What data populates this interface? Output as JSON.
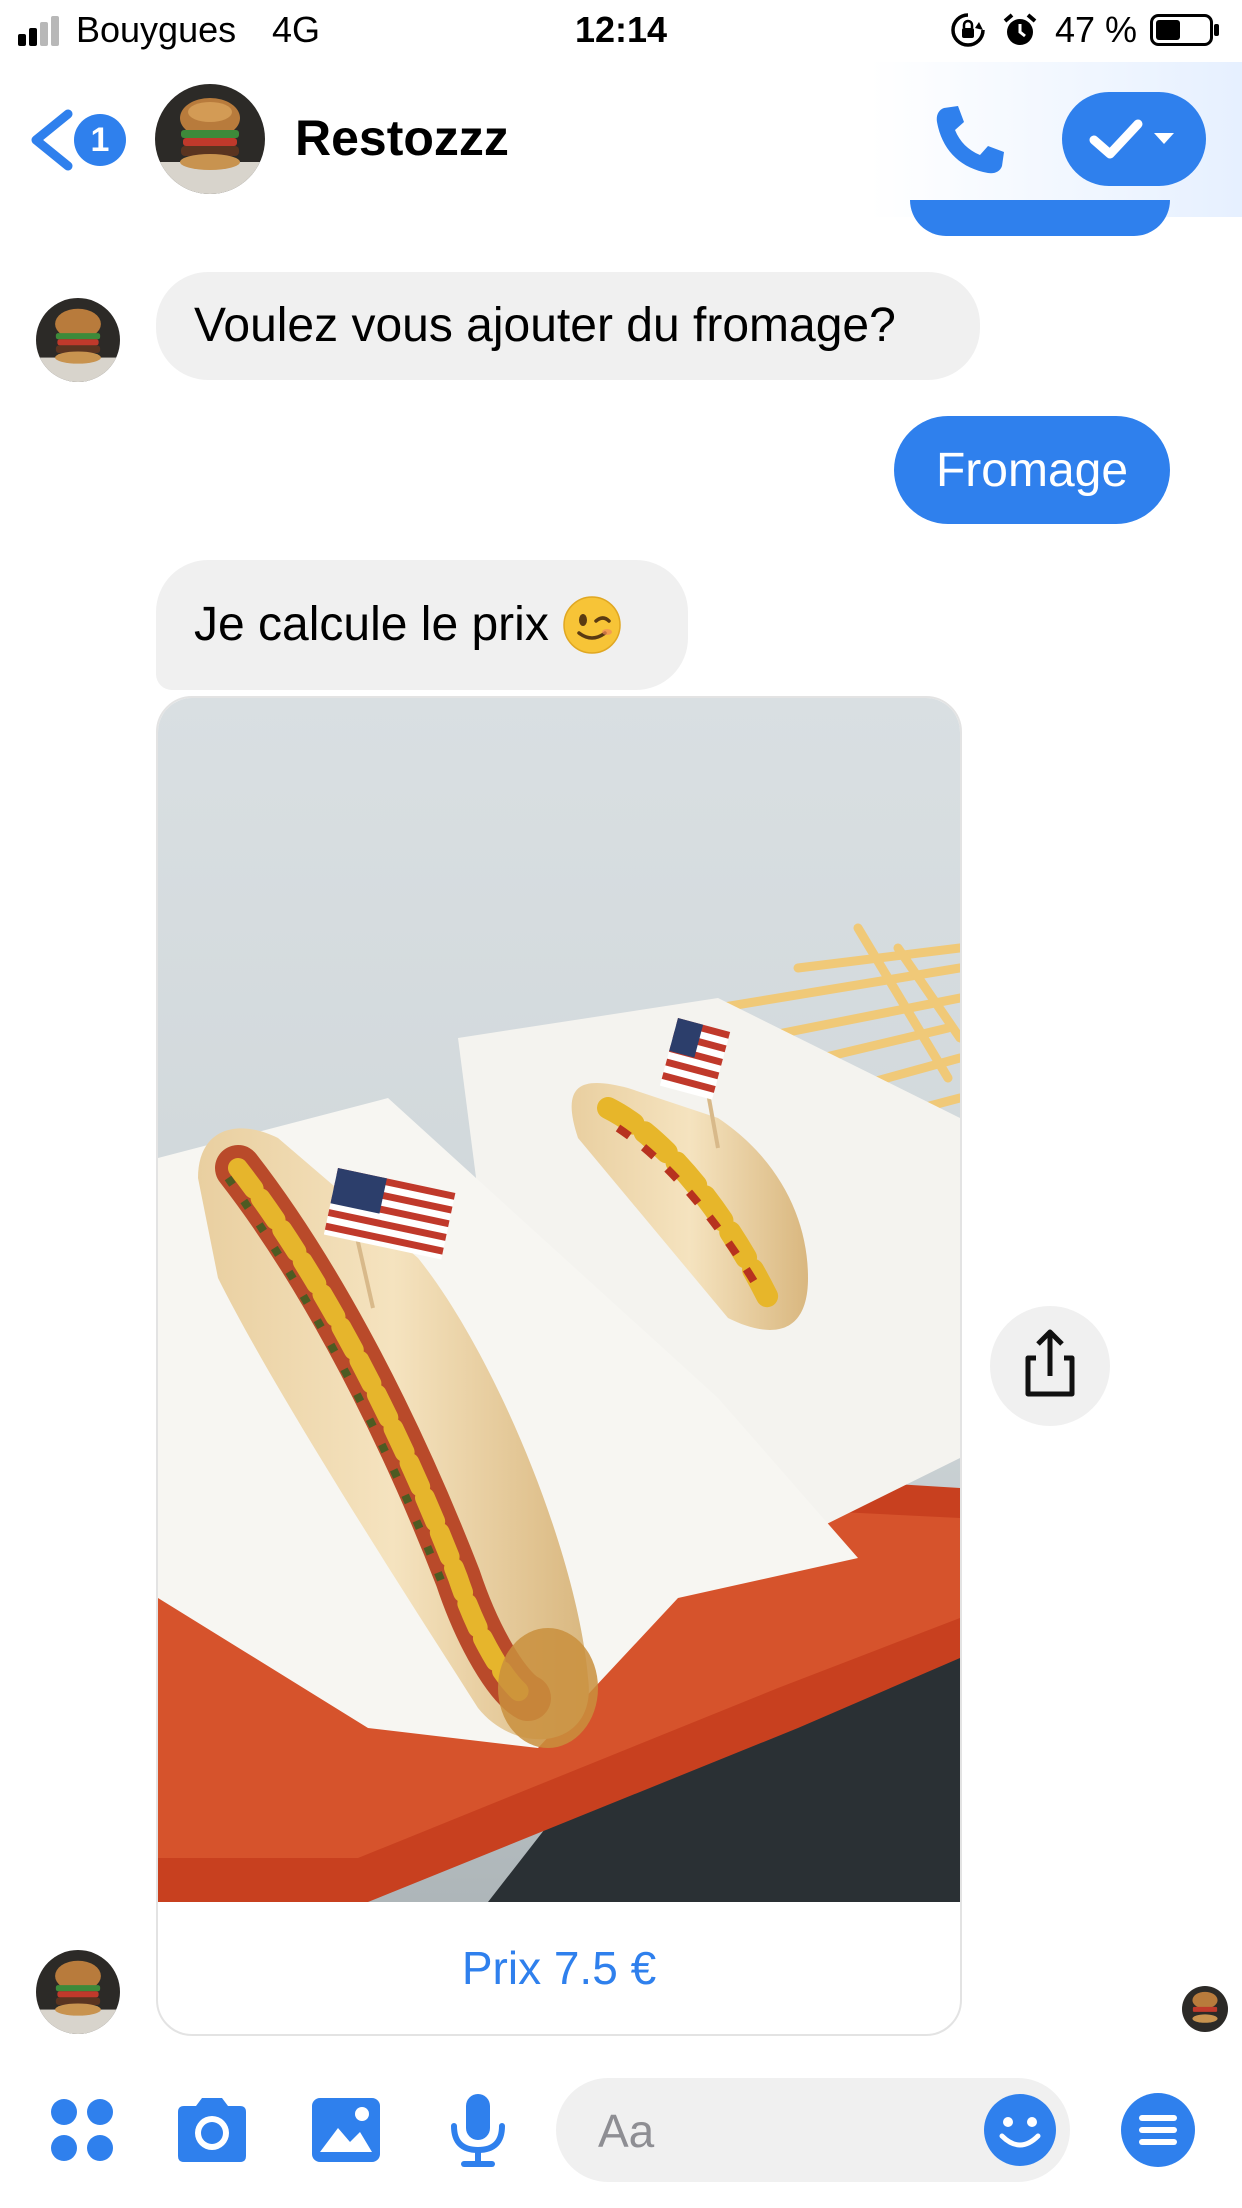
{
  "status_bar": {
    "carrier": "Bouygues",
    "network": "4G",
    "time": "12:14",
    "battery_percent": "47 %",
    "battery_level": 0.47,
    "icons": [
      "signal-icon",
      "rotation-lock-icon",
      "alarm-icon",
      "battery-icon"
    ]
  },
  "header": {
    "back_badge": "1",
    "contact_name": "Restozzz",
    "icons": [
      "back-chevron-icon",
      "phone-icon",
      "checkmark-icon",
      "dropdown-caret-icon"
    ]
  },
  "messages": [
    {
      "from": "bot",
      "text": "Voulez vous ajouter du fromage?"
    },
    {
      "from": "me",
      "text": "Fromage"
    },
    {
      "from": "bot",
      "text": "Je calcule le prix",
      "emoji": "winking-face"
    },
    {
      "from": "bot",
      "type": "card",
      "image": "hot-dogs-photo",
      "caption": "Prix 7.5 €"
    }
  ],
  "share": {
    "icon": "share-icon"
  },
  "composer": {
    "placeholder": "Aa",
    "icons": [
      "apps-icon",
      "camera-icon",
      "gallery-icon",
      "microphone-icon",
      "emoji-icon",
      "menu-icon"
    ]
  },
  "colors": {
    "accent": "#2f80ed",
    "bubble_incoming": "#f0f0f0",
    "text": "#000000"
  }
}
